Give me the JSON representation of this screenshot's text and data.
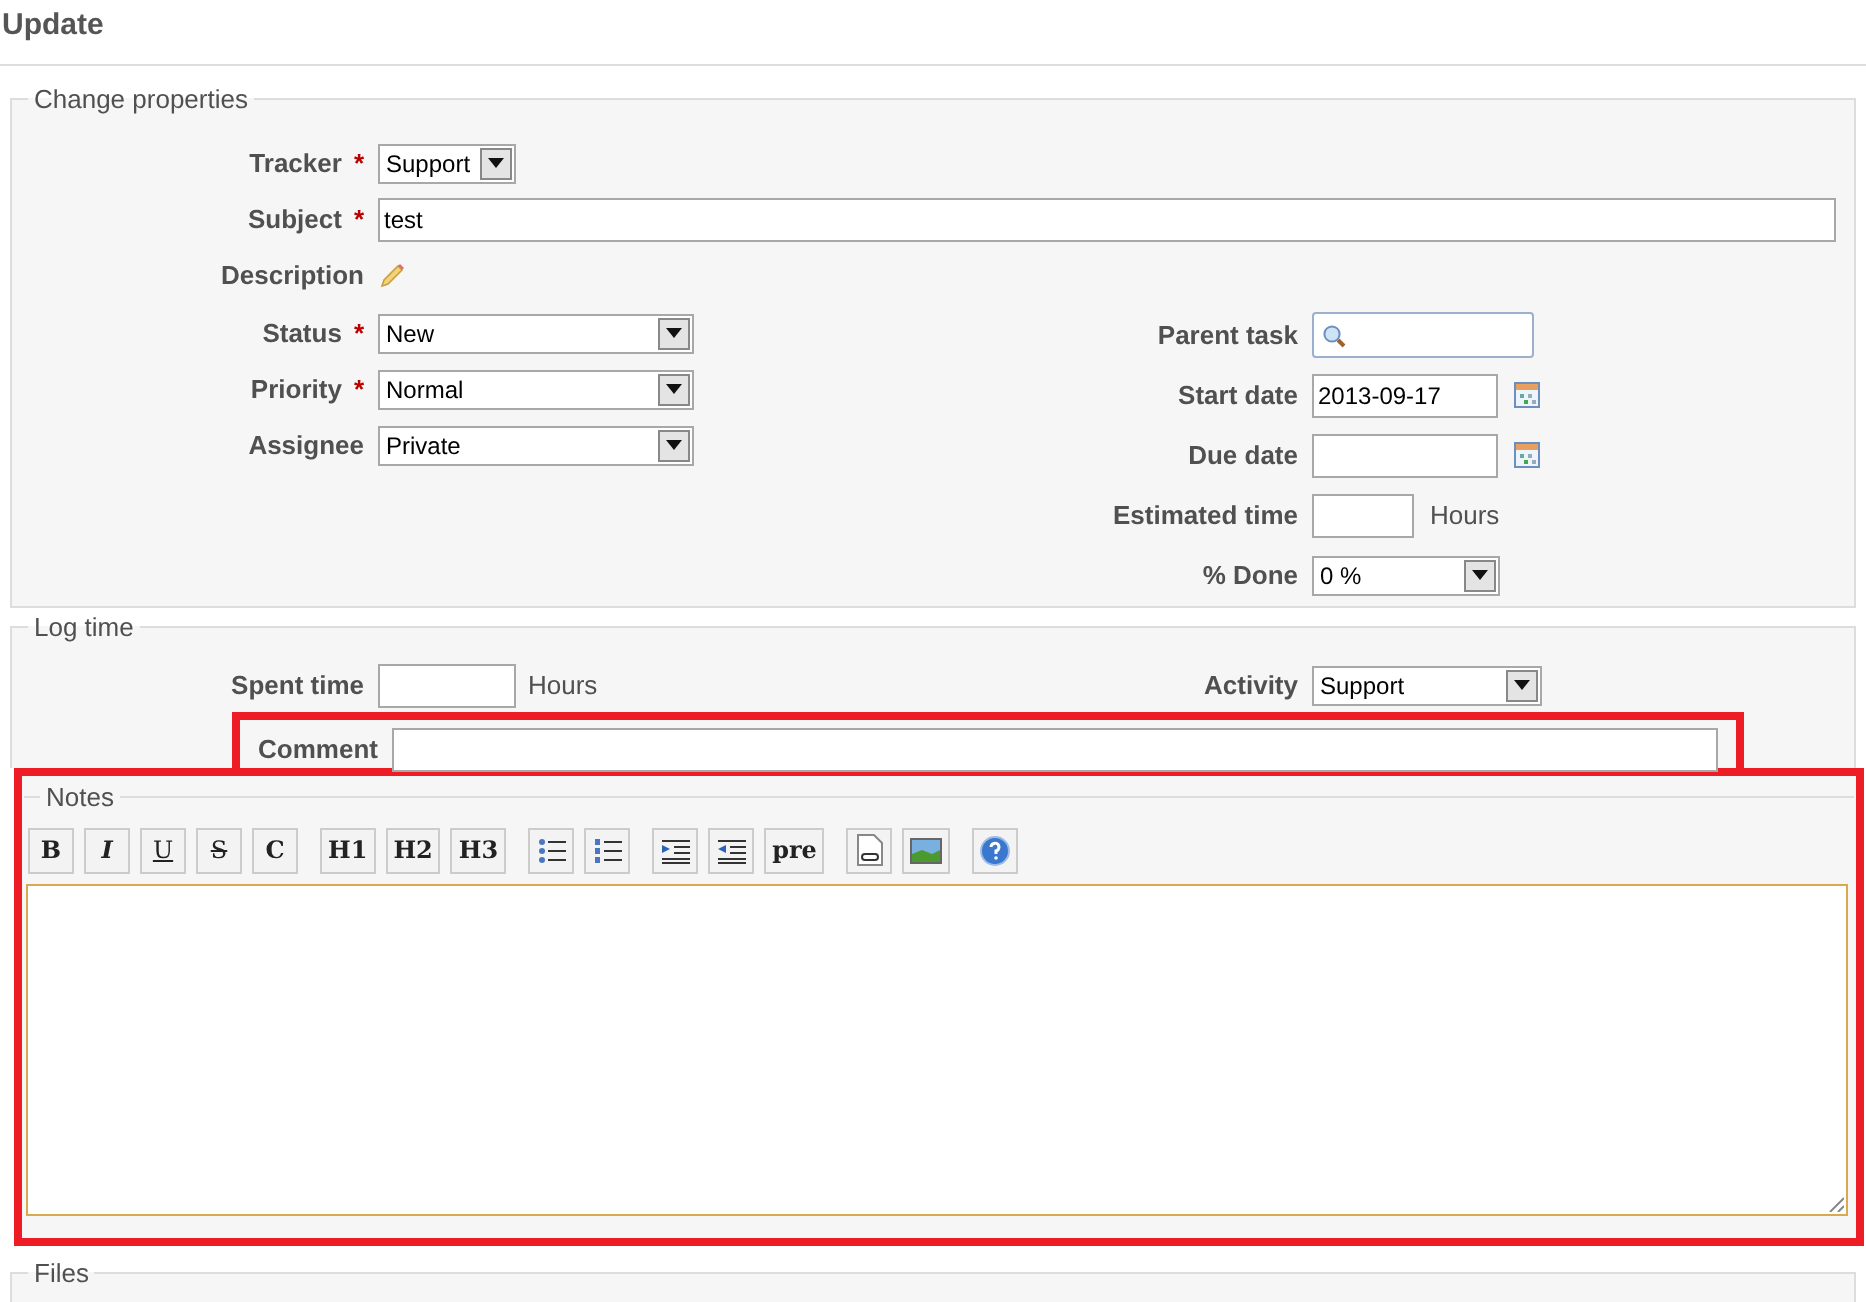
{
  "title": "Update",
  "properties": {
    "legend": "Change properties",
    "top_fields": [
      {
        "kind": "select",
        "label": "Tracker",
        "required_mark": "*",
        "value": "Support"
      },
      {
        "kind": "text",
        "label": "Subject",
        "required_mark": "*",
        "value": "test"
      },
      {
        "kind": "edit",
        "label": "Description"
      }
    ],
    "left_fields": [
      {
        "kind": "select",
        "label": "Status",
        "required_mark": "*",
        "value": "New"
      },
      {
        "kind": "select",
        "label": "Priority",
        "required_mark": "*",
        "value": "Normal"
      },
      {
        "kind": "select",
        "label": "Assignee",
        "value": "Private"
      }
    ],
    "right_fields": [
      {
        "kind": "search",
        "label": "Parent task"
      },
      {
        "kind": "date",
        "label": "Start date",
        "value": "2013-09-17"
      },
      {
        "kind": "date",
        "label": "Due date"
      },
      {
        "kind": "hours",
        "label": "Estimated time",
        "unit": "Hours"
      },
      {
        "kind": "select",
        "label": "% Done",
        "value": "0 %"
      }
    ]
  },
  "log_time": {
    "legend": "Log time",
    "spent": {
      "label": "Spent time",
      "unit": "Hours"
    },
    "activity": {
      "label": "Activity",
      "value": "Support"
    },
    "comment": {
      "label": "Comment"
    }
  },
  "notes": {
    "legend": "Notes",
    "toolbar": [
      [
        {
          "kind": "text",
          "label": "B"
        },
        {
          "kind": "text",
          "label": "I"
        },
        {
          "kind": "text",
          "label": "U"
        },
        {
          "kind": "text",
          "label": "S"
        },
        {
          "kind": "text",
          "label": "C"
        }
      ],
      [
        {
          "kind": "text",
          "label": "H1"
        },
        {
          "kind": "text",
          "label": "H2"
        },
        {
          "kind": "text",
          "label": "H3"
        }
      ],
      [
        {
          "kind": "bulleted-list"
        },
        {
          "kind": "numbered-list"
        }
      ],
      [
        {
          "kind": "indent"
        },
        {
          "kind": "outdent"
        },
        {
          "kind": "text",
          "label": "pre"
        }
      ],
      [
        {
          "kind": "link"
        },
        {
          "kind": "image"
        }
      ],
      [
        {
          "kind": "help"
        }
      ]
    ]
  },
  "files": {
    "legend": "Files"
  }
}
